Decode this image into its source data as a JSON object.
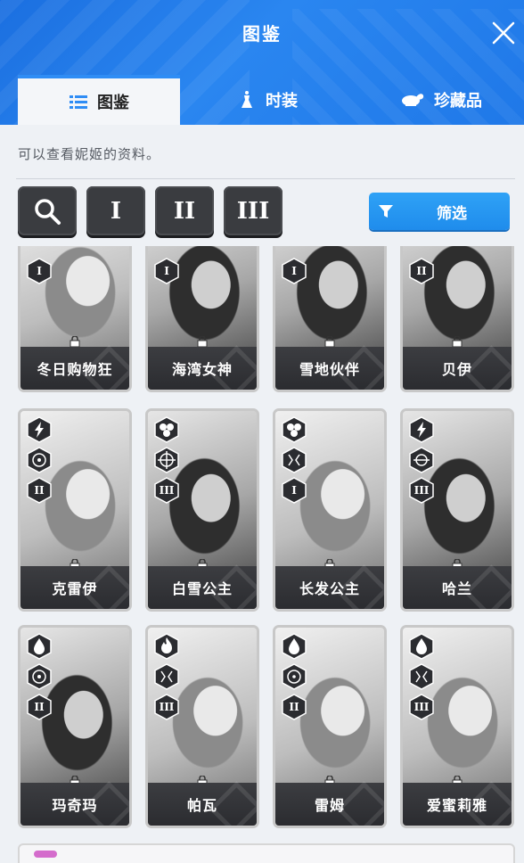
{
  "header": {
    "title": "图鉴"
  },
  "tabs": [
    {
      "label": "图鉴",
      "icon": "list-icon",
      "active": true
    },
    {
      "label": "时装",
      "icon": "dress-icon",
      "active": false
    },
    {
      "label": "珍藏品",
      "icon": "collectible-icon",
      "active": false
    }
  ],
  "description": "可以查看妮姬的资料。",
  "filters": {
    "burst_1": "I",
    "burst_2": "II",
    "burst_3": "III",
    "filter_label": "筛选"
  },
  "colors": {
    "header_blue": "#1f78e8",
    "tab_underline": "#2f8df5",
    "filter_button": "#2196f3",
    "card_nameplate": "#333438"
  },
  "cards": [
    {
      "name": "冬日购物狂",
      "badges": [
        "I"
      ]
    },
    {
      "name": "海湾女神",
      "badges": [
        "I"
      ]
    },
    {
      "name": "雪地伙伴",
      "badges": [
        "I"
      ]
    },
    {
      "name": "贝伊",
      "badges": [
        "II"
      ]
    },
    {
      "name": "克雷伊",
      "badges": [
        "electric-icon",
        "shotgun-icon",
        "II"
      ]
    },
    {
      "name": "白雪公主",
      "badges": [
        "iron-icon",
        "sniper-icon",
        "III"
      ]
    },
    {
      "name": "长发公主",
      "badges": [
        "iron-icon",
        "rocket-icon",
        "I"
      ]
    },
    {
      "name": "哈兰",
      "badges": [
        "electric-icon",
        "rocket-icon",
        "III"
      ]
    },
    {
      "name": "玛奇玛",
      "badges": [
        "water-icon",
        "shotgun-icon",
        "II"
      ]
    },
    {
      "name": "帕瓦",
      "badges": [
        "fire-icon",
        "rocket-icon",
        "III"
      ]
    },
    {
      "name": "雷姆",
      "badges": [
        "water-icon",
        "assault-rifle-icon",
        "II"
      ]
    },
    {
      "name": "爱蜜莉雅",
      "badges": [
        "water-icon",
        "rocket-icon",
        "III"
      ]
    }
  ]
}
